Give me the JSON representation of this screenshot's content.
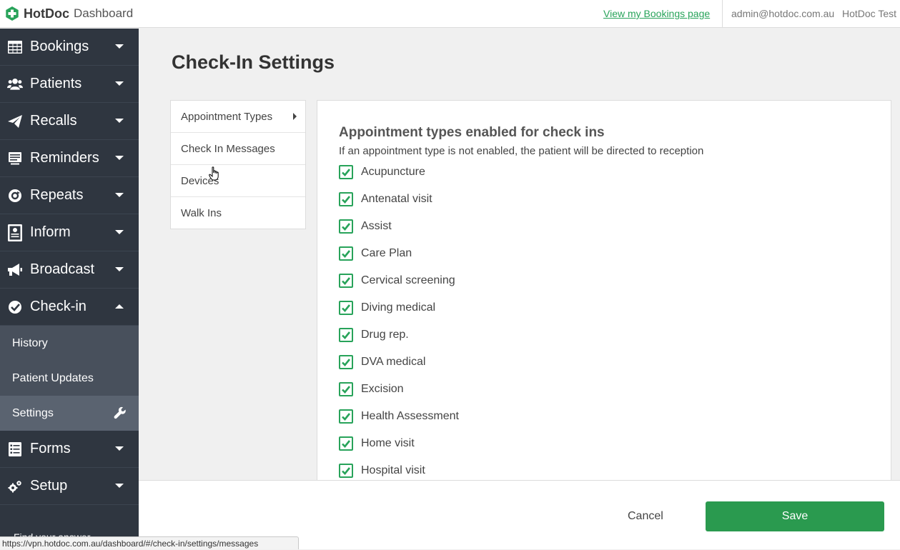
{
  "header": {
    "brand": "HotDoc",
    "product": "Dashboard",
    "bookings_link": "View my Bookings page",
    "user_email": "admin@hotdoc.com.au",
    "practice_name": "HotDoc Test"
  },
  "sidebar": {
    "items": [
      {
        "label": "Bookings",
        "icon": "table-icon"
      },
      {
        "label": "Patients",
        "icon": "users-icon"
      },
      {
        "label": "Recalls",
        "icon": "paper-plane-icon"
      },
      {
        "label": "Reminders",
        "icon": "list-icon"
      },
      {
        "label": "Repeats",
        "icon": "refresh-icon"
      },
      {
        "label": "Inform",
        "icon": "document-icon"
      },
      {
        "label": "Broadcast",
        "icon": "megaphone-icon"
      },
      {
        "label": "Check-in",
        "icon": "check-circle-icon"
      }
    ],
    "checkin_sub": [
      {
        "label": "History"
      },
      {
        "label": "Patient Updates"
      },
      {
        "label": "Settings"
      }
    ],
    "bottom_items": [
      {
        "label": "Forms",
        "icon": "form-icon"
      },
      {
        "label": "Setup",
        "icon": "cogs-icon"
      }
    ],
    "truncated_text": "Find your answer"
  },
  "page": {
    "title": "Check-In Settings"
  },
  "subnav": {
    "items": [
      {
        "label": "Appointment Types"
      },
      {
        "label": "Check In Messages"
      },
      {
        "label": "Devices"
      },
      {
        "label": "Walk Ins"
      }
    ]
  },
  "panel": {
    "title": "Appointment types enabled for check ins",
    "description": "If an appointment type is not enabled, the patient will be directed to reception",
    "types": [
      {
        "label": "Acupuncture",
        "checked": true
      },
      {
        "label": "Antenatal visit",
        "checked": true
      },
      {
        "label": "Assist",
        "checked": true
      },
      {
        "label": "Care Plan",
        "checked": true
      },
      {
        "label": "Cervical screening",
        "checked": true
      },
      {
        "label": "Diving medical",
        "checked": true
      },
      {
        "label": "Drug rep.",
        "checked": true
      },
      {
        "label": "DVA medical",
        "checked": true
      },
      {
        "label": "Excision",
        "checked": true
      },
      {
        "label": "Health Assessment",
        "checked": true
      },
      {
        "label": "Home visit",
        "checked": true
      },
      {
        "label": "Hospital visit",
        "checked": true
      }
    ]
  },
  "footer": {
    "cancel_label": "Cancel",
    "save_label": "Save"
  },
  "status_bar": {
    "url": "https://vpn.hotdoc.com.au/dashboard/#/check-in/settings/messages"
  },
  "colors": {
    "brand_green": "#28a35a",
    "sidebar_bg": "#2f3640",
    "save_button": "#2a9a4f"
  }
}
